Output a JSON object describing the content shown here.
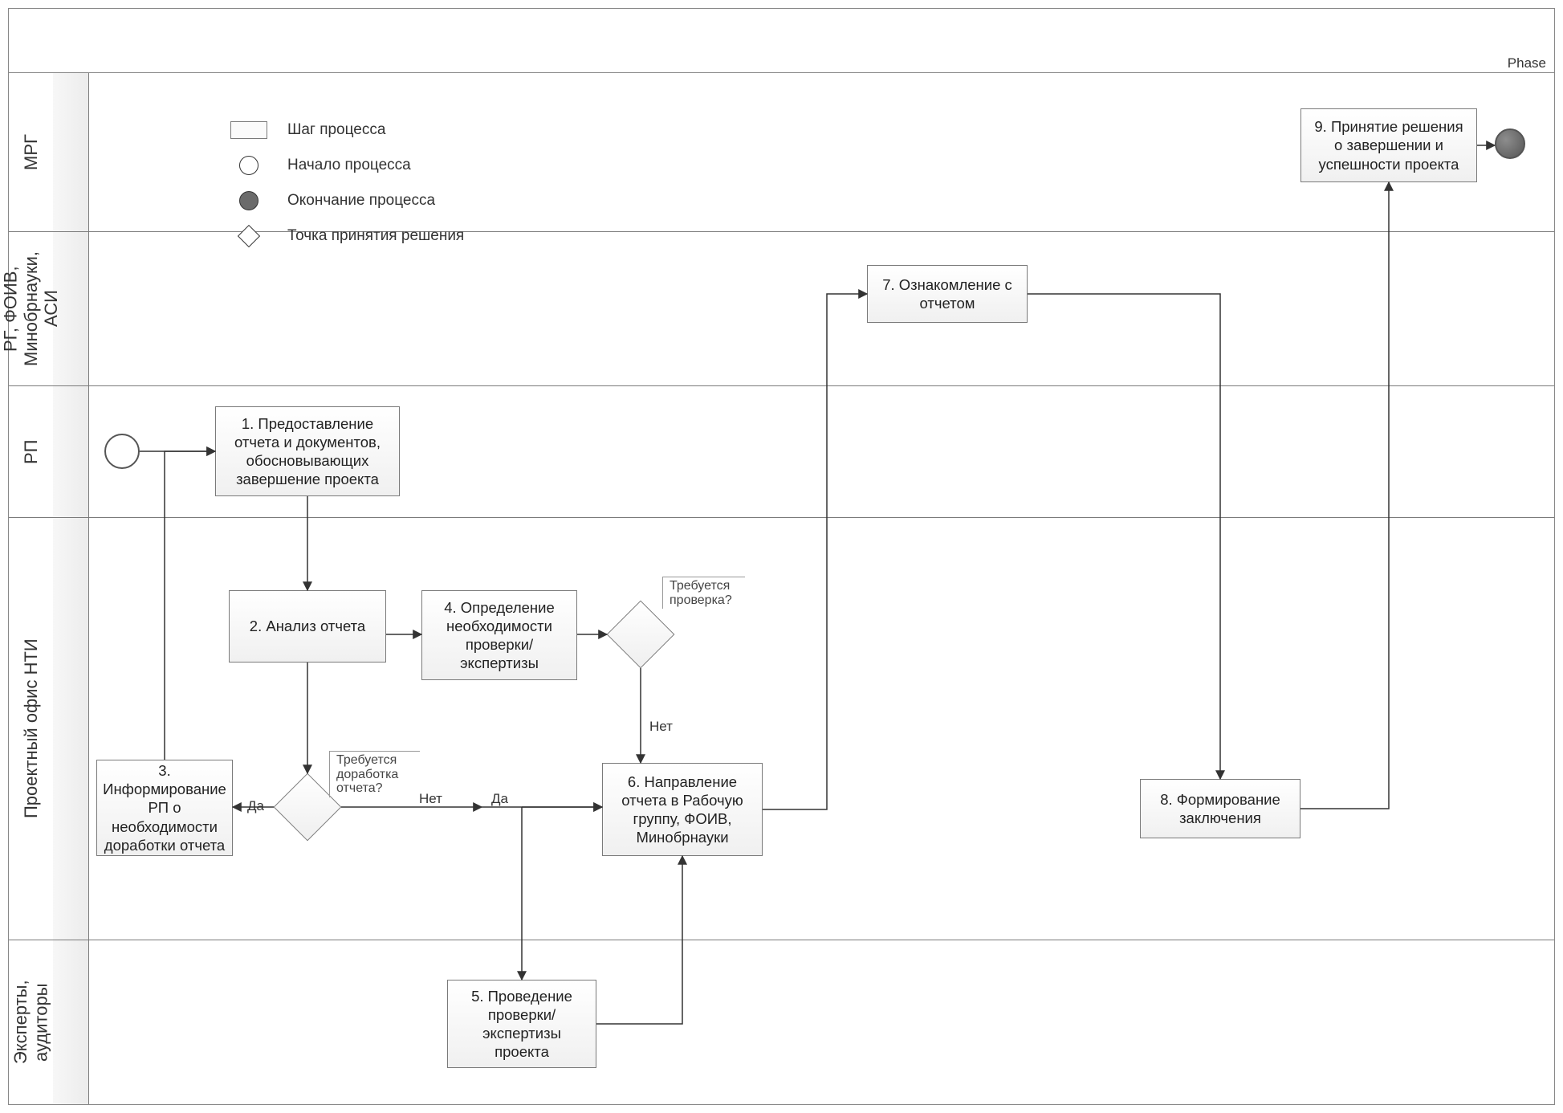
{
  "phase_label": "Phase",
  "lanes": {
    "l1": "МРГ",
    "l2": "РГ, ФОИВ, Минобрнауки, АСИ",
    "l3": "РП",
    "l4": "Проектный офис НТИ",
    "l5": "Эксперты, аудиторы"
  },
  "legend": {
    "step": "Шаг процесса",
    "start": "Начало процесса",
    "end": "Окончание процесса",
    "decision": "Точка принятия решения"
  },
  "nodes": {
    "n1": "1. Предоставление отчета и  документов, обосновывающих завершение проекта",
    "n2": "2. Анализ  отчета",
    "n3": "3. Информирование РП о необходимости доработки отчета",
    "n4": "4. Определение необходимости проверки/ экспертизы",
    "n5": "5. Проведение проверки/ экспертизы проекта",
    "n6": "6. Направление отчета в Рабочую группу, ФОИВ, Минобрнауки",
    "n7": "7. Ознакомление с отчетом",
    "n8": "8. Формирование заключения",
    "n9": "9. Принятие решения о завершении и успешности проекта"
  },
  "gateway_notes": {
    "g1": "Требуется доработка отчета?",
    "g2": "Требуется проверка?"
  },
  "edge_labels": {
    "yes": "Да",
    "no": "Нет"
  }
}
